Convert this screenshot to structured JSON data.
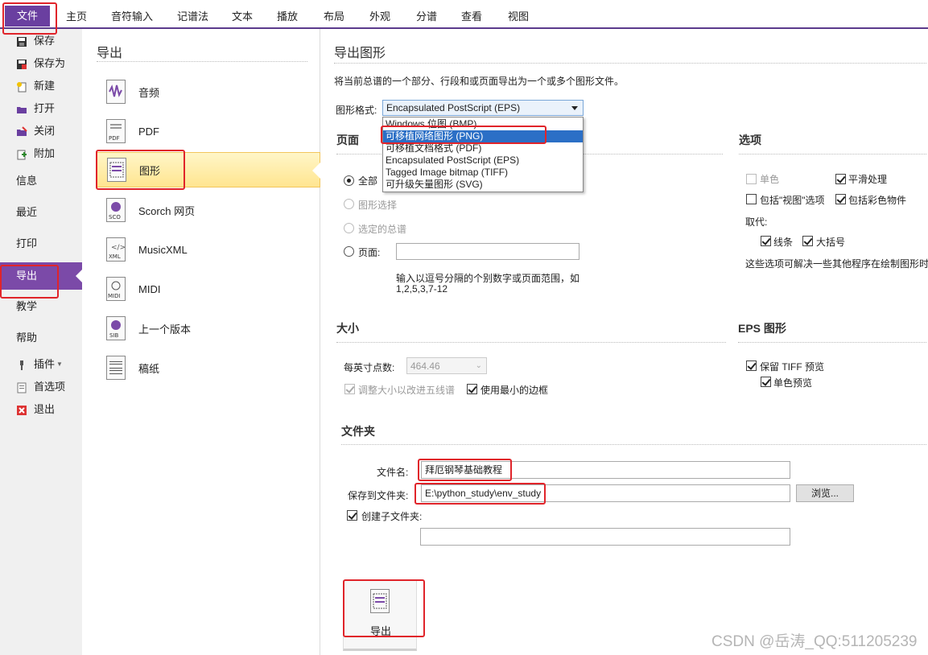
{
  "ribbon": {
    "tabs": [
      "文件",
      "主页",
      "音符输入",
      "记谱法",
      "文本",
      "播放",
      "布局",
      "外观",
      "分谱",
      "查看",
      "视图"
    ]
  },
  "backstage_nav": {
    "small_items": [
      {
        "label": "保存",
        "icon": "save-icon"
      },
      {
        "label": "保存为",
        "icon": "save-as-icon"
      },
      {
        "label": "新建",
        "icon": "new-icon"
      },
      {
        "label": "打开",
        "icon": "open-folder-icon"
      },
      {
        "label": "关闭",
        "icon": "close-folder-icon"
      },
      {
        "label": "附加",
        "icon": "append-icon"
      }
    ],
    "big_items": [
      "信息",
      "最近",
      "打印",
      "导出",
      "教学",
      "帮助"
    ],
    "bottom_items": [
      {
        "label": "插件",
        "icon": "plugin-icon"
      },
      {
        "label": "首选项",
        "icon": "preferences-icon"
      },
      {
        "label": "退出",
        "icon": "exit-icon"
      }
    ]
  },
  "export_panel": {
    "heading": "导出",
    "options": [
      {
        "label": "音频",
        "icon": "audio-file-icon"
      },
      {
        "label": "PDF",
        "icon": "pdf-file-icon"
      },
      {
        "label": "图形",
        "icon": "graphics-file-icon"
      },
      {
        "label": "Scorch 网页",
        "icon": "scorch-file-icon"
      },
      {
        "label": "MusicXML",
        "icon": "xml-file-icon"
      },
      {
        "label": "MIDI",
        "icon": "midi-file-icon"
      },
      {
        "label": "上一个版本",
        "icon": "sib-file-icon"
      },
      {
        "label": "稿纸",
        "icon": "manuscript-file-icon"
      }
    ],
    "selected": "图形"
  },
  "graphics": {
    "title": "导出图形",
    "description": "将当前总谱的一个部分、行段和或页面导出为一个或多个图形文件。",
    "format_label": "图形格式:",
    "format_value": "Encapsulated PostScript (EPS)",
    "format_options": [
      "Windows 位图 (BMP)",
      "可移植网络图形 (PNG)",
      "可移植文档格式 (PDF)",
      "Encapsulated PostScript (EPS)",
      "Tagged Image bitmap (TIFF)",
      "可升级矢量图形 (SVG)"
    ],
    "highlighted_option": "可移植网络图形 (PNG)"
  },
  "pages_section": {
    "title": "页面",
    "radio_all": "全部",
    "radio_selection": "图形选择",
    "radio_selected_staves": "选定的总谱",
    "radio_pages": "页面:",
    "pages_value": "",
    "hint_line1": "输入以逗号分隔的个别数字或页面范围，如",
    "hint_line2": "1,2,5,3,7-12"
  },
  "options_section": {
    "title": "选项",
    "mono": "单色",
    "smoothing": "平滑处理",
    "include_view": "包括\"视图\"选项",
    "include_color": "包括彩色物件",
    "replace_label": "取代:",
    "lines": "线条",
    "brackets": "大括号",
    "note": "这些选项可解决一些其他程序在绘制图形时"
  },
  "size_section": {
    "title": "大小",
    "dpi_label": "每英寸点数:",
    "dpi_value": "464.46",
    "adjust_size": "调整大小以改进五线谱",
    "min_border": "使用最小的边框"
  },
  "eps_section": {
    "title": "EPS 图形",
    "keep_tiff": "保留 TIFF 预览",
    "mono_preview": "单色预览"
  },
  "folder_section": {
    "title": "文件夹",
    "filename_label": "文件名:",
    "filename_value": "拜厄钢琴基础教程",
    "save_to_label": "保存到文件夹:",
    "save_to_value": "E:\\python_study\\env_study",
    "browse_label": "浏览...",
    "create_subfolder": "创建子文件夹:",
    "subfolder_value": ""
  },
  "export_button": {
    "label": "导出",
    "icon": "graphics-file-icon"
  },
  "watermark": "CSDN @岳涛_QQ:511205239",
  "colors": {
    "accent": "#6a3fa0",
    "highlight": "#e0242a",
    "selection": "#2b6fc6"
  }
}
